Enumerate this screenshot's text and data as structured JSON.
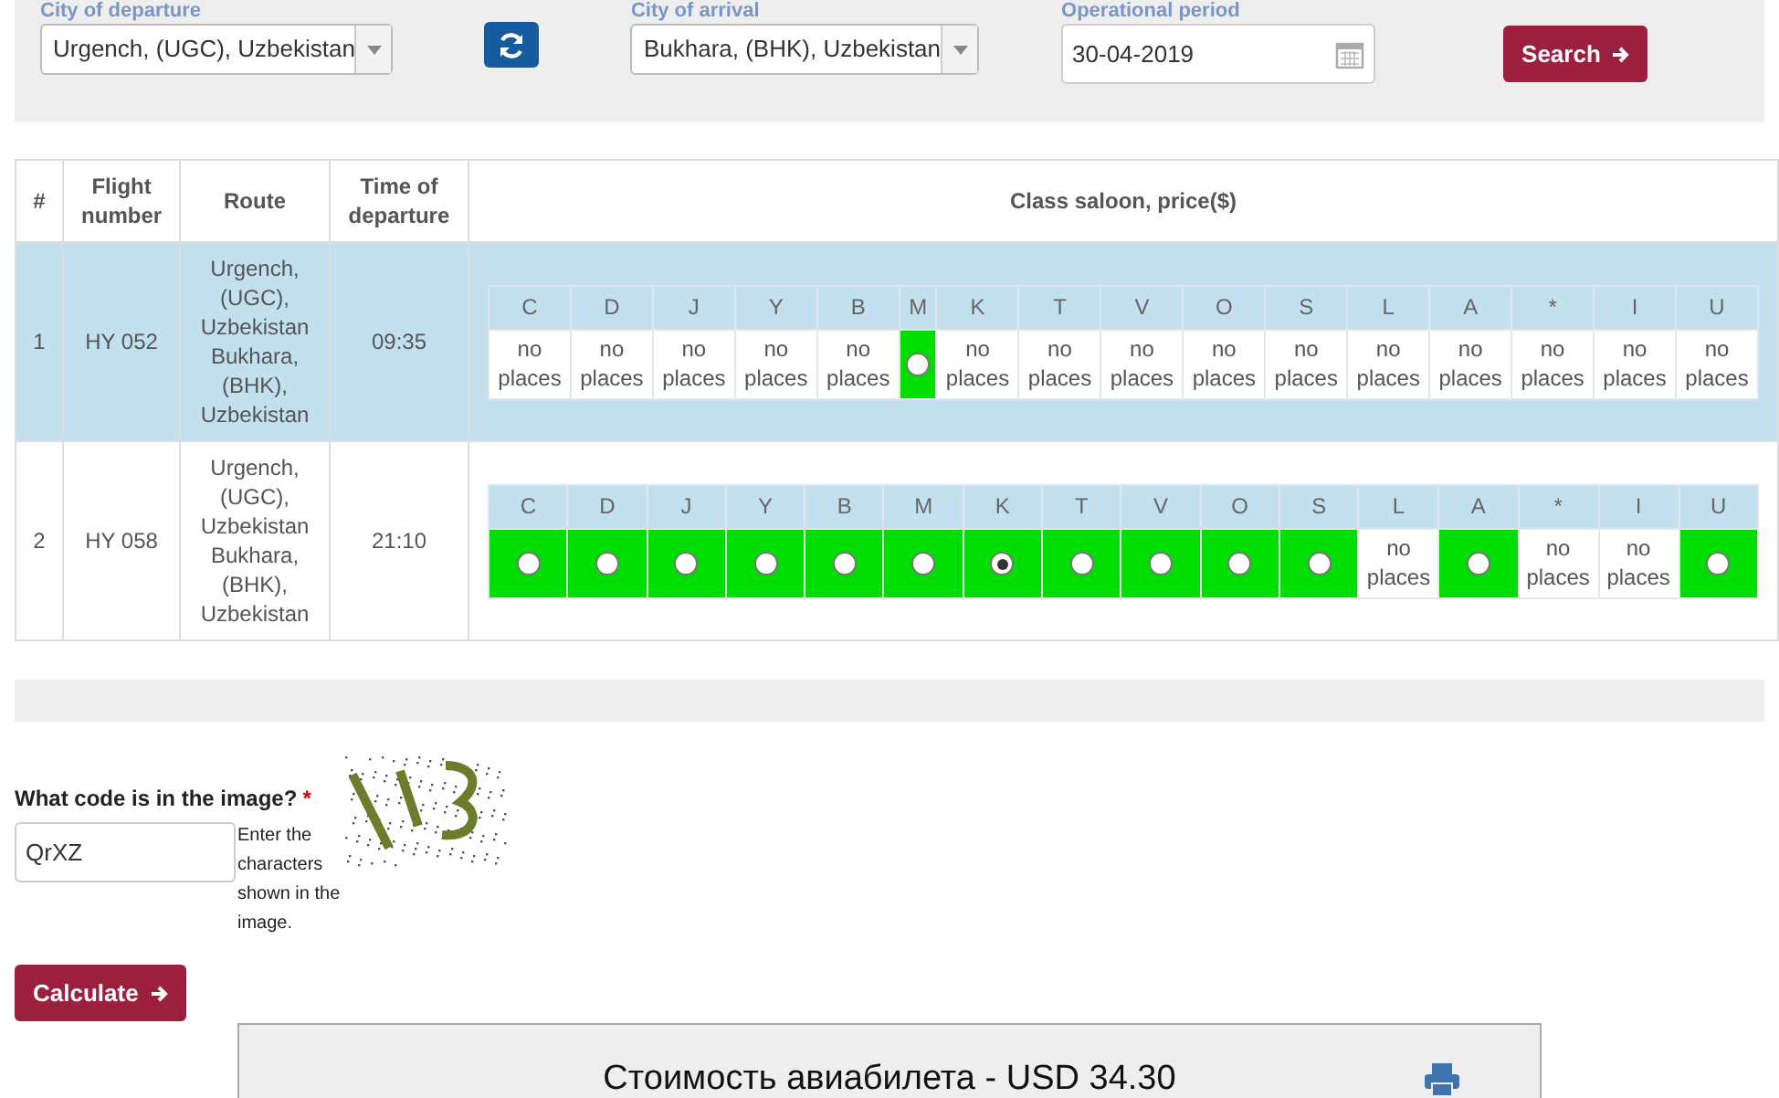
{
  "search_form": {
    "departure": {
      "label": "City of departure",
      "value": "Urgench, (UGC), Uzbekistan"
    },
    "arrival": {
      "label": "City of arrival",
      "value": "Bukhara, (BHK), Uzbekistan"
    },
    "period": {
      "label": "Operational period",
      "value": "30-04-2019"
    },
    "search_button": "Search"
  },
  "table": {
    "columns": [
      "#",
      "Flight number",
      "Route",
      "Time of departure",
      "Class saloon, price($)"
    ],
    "rows": [
      {
        "number": "1",
        "flight": "HY 052",
        "route": "Urgench, (UGC), Uzbekistan Bukhara, (BHK), Uzbekistan",
        "time": "09:35",
        "highlighted": true,
        "classes": [
          {
            "code": "C",
            "kind": "full",
            "text": "no places"
          },
          {
            "code": "D",
            "kind": "full",
            "text": "no places"
          },
          {
            "code": "J",
            "kind": "full",
            "text": "no places"
          },
          {
            "code": "Y",
            "kind": "full",
            "text": "no places"
          },
          {
            "code": "B",
            "kind": "full",
            "text": "no places"
          },
          {
            "code": "M",
            "kind": "open",
            "selected": false
          },
          {
            "code": "K",
            "kind": "full",
            "text": "no places"
          },
          {
            "code": "T",
            "kind": "full",
            "text": "no places"
          },
          {
            "code": "V",
            "kind": "full",
            "text": "no places"
          },
          {
            "code": "O",
            "kind": "full",
            "text": "no places"
          },
          {
            "code": "S",
            "kind": "full",
            "text": "no places"
          },
          {
            "code": "L",
            "kind": "full",
            "text": "no places"
          },
          {
            "code": "A",
            "kind": "full",
            "text": "no places"
          },
          {
            "code": "*",
            "kind": "full",
            "text": "no places"
          },
          {
            "code": "I",
            "kind": "full",
            "text": "no places"
          },
          {
            "code": "U",
            "kind": "full",
            "text": "no places"
          }
        ]
      },
      {
        "number": "2",
        "flight": "HY 058",
        "route": "Urgench, (UGC), Uzbekistan Bukhara, (BHK), Uzbekistan",
        "time": "21:10",
        "highlighted": false,
        "classes": [
          {
            "code": "C",
            "kind": "open",
            "selected": false
          },
          {
            "code": "D",
            "kind": "open",
            "selected": false
          },
          {
            "code": "J",
            "kind": "open",
            "selected": false
          },
          {
            "code": "Y",
            "kind": "open",
            "selected": false
          },
          {
            "code": "B",
            "kind": "open",
            "selected": false
          },
          {
            "code": "M",
            "kind": "open",
            "selected": false
          },
          {
            "code": "K",
            "kind": "open",
            "selected": true
          },
          {
            "code": "T",
            "kind": "open",
            "selected": false
          },
          {
            "code": "V",
            "kind": "open",
            "selected": false
          },
          {
            "code": "O",
            "kind": "open",
            "selected": false
          },
          {
            "code": "S",
            "kind": "open",
            "selected": false
          },
          {
            "code": "L",
            "kind": "full",
            "text": "no places"
          },
          {
            "code": "A",
            "kind": "open",
            "selected": false
          },
          {
            "code": "*",
            "kind": "full",
            "text": "no places"
          },
          {
            "code": "I",
            "kind": "full",
            "text": "no places"
          },
          {
            "code": "U",
            "kind": "open",
            "selected": false
          }
        ]
      }
    ]
  },
  "captcha": {
    "label": "What code is in the image?",
    "required_mark": "*",
    "value": "QrXZ",
    "hint": "Enter the characters shown in the image."
  },
  "calculate_button": "Calculate",
  "result": {
    "text": "Стоимость авиабилета - USD 34.30"
  }
}
